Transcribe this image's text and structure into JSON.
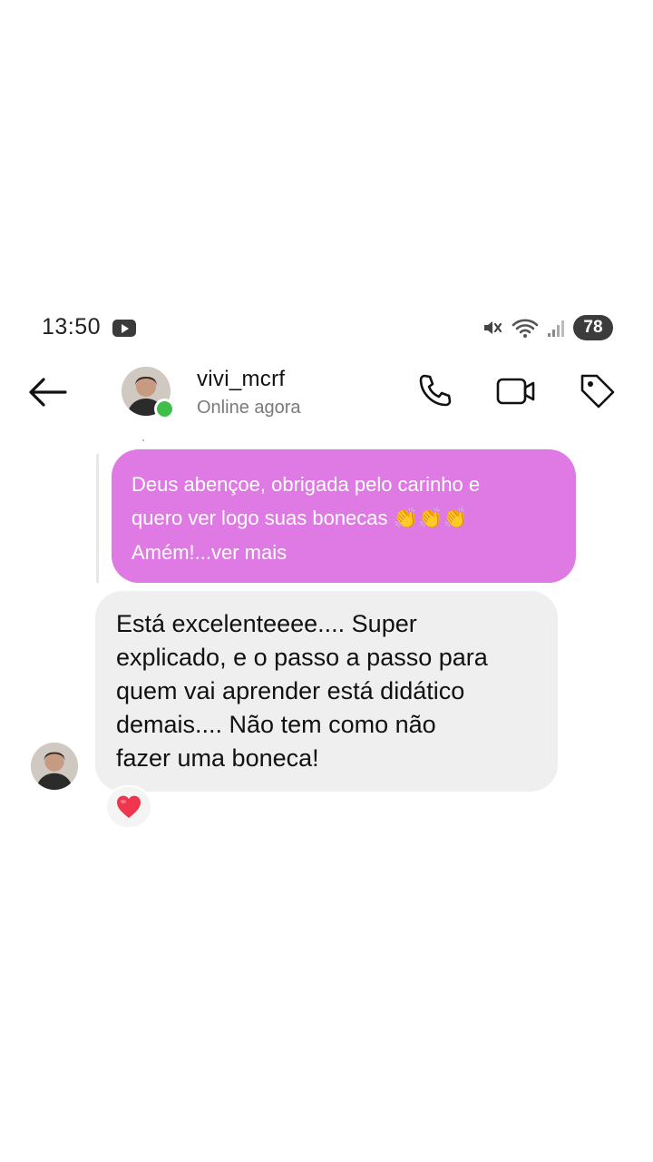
{
  "status": {
    "time": "13:50",
    "battery": "78"
  },
  "header": {
    "username": "vivi_mcrf",
    "presence": "Online agora"
  },
  "reply": {
    "lines": [
      "Deus abençoe, obrigada pelo carinho e",
      "quero ver logo suas bonecas",
      "Amém!...ver mais"
    ],
    "emoji": "👏👏👏"
  },
  "message": {
    "lines": [
      "Está excelenteeee.... Super",
      "explicado, e o passo a passo para",
      "quem vai aprender está didático",
      "demais.... Não tem como não",
      "fazer uma boneca!"
    ]
  },
  "reaction": {
    "emoji": "heart"
  },
  "colors": {
    "reply_bubble": "#df79e4",
    "message_bubble": "#efefef",
    "online": "#3fbf4a",
    "heart": "#f0354f"
  }
}
